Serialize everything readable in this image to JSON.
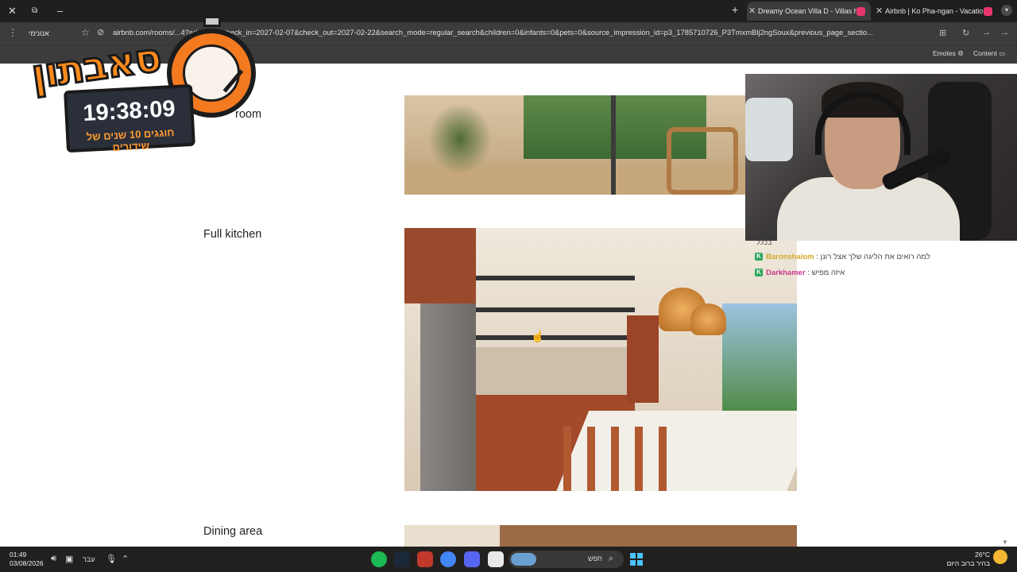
{
  "browser": {
    "tabs": [
      {
        "label": "Dreamy Ocean Villa D - Villas h",
        "active": true
      },
      {
        "label": "Airbnb | Ko Pha-ngan - Vacatio",
        "active": false
      }
    ],
    "incognito_label": "אנונימי",
    "url": "airbnb.com/rooms/...4?adults=5&check_in=2027-02-07&check_out=2027-02-22&search_mode=regular_search&children=0&infants=0&pets=0&source_impression_id=p3_1785710726_P3TmxmBlj2ngSoux&previous_page_sectio...",
    "extensions": {
      "emotes": "Emotes",
      "content": "Content"
    }
  },
  "page": {
    "sections": [
      {
        "label": "room"
      },
      {
        "label": "Full kitchen"
      },
      {
        "label": "Dining area"
      }
    ]
  },
  "overlay": {
    "logo_text": "סאבתון",
    "timer": "19:38:09",
    "timer_subtitle": "חוגגים 10 שנים של שידורים"
  },
  "chat": {
    "header": "בכלל",
    "messages": [
      {
        "user": "Baronshalom",
        "user_color": "#d4a92a",
        "text": ": למה רואים את הליגה שלך אצל רונן"
      },
      {
        "user": "Darkhamer",
        "user_color": "#c83a8c",
        "text": ": איזה מפיש"
      }
    ]
  },
  "taskbar": {
    "time": "01:49",
    "date": "03/08/2026",
    "lang": "עבר",
    "search_placeholder": "חפש",
    "temperature": "26°C",
    "weather_text": "בהיר ברוב היום"
  }
}
